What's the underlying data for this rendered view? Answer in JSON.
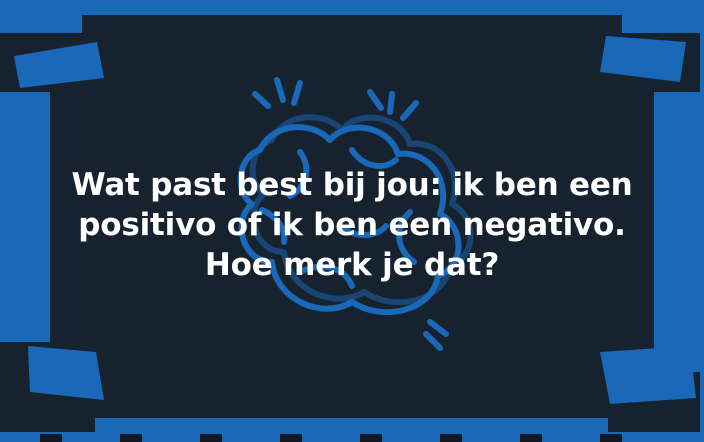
{
  "card": {
    "question": "Wat past best bij jou: ik ben een positivo of ik ben een negativo. Hoe merk je dat?"
  },
  "colors": {
    "frame": "#1a68b8",
    "card": "#16232f",
    "illustration": "#1a68b8",
    "text": "#ffffff"
  },
  "icons": {
    "illustration": "brain-with-sparks-icon"
  }
}
